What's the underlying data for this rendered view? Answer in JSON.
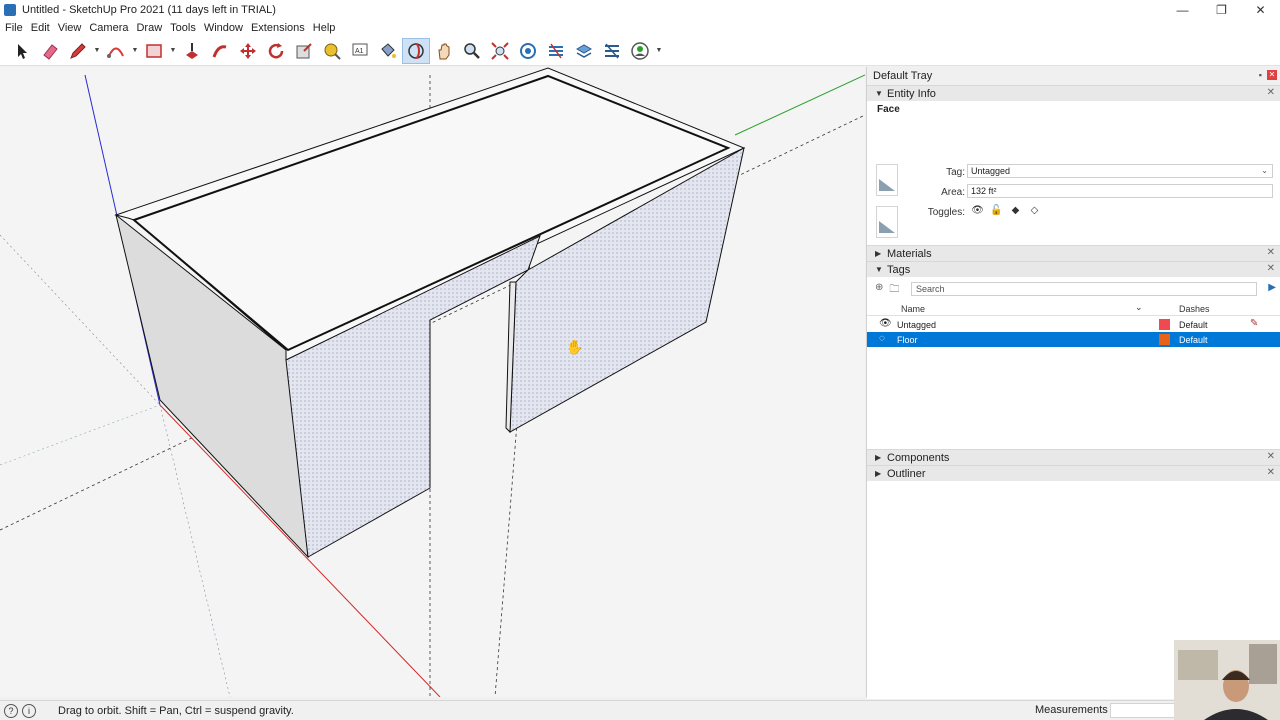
{
  "window": {
    "title": "Untitled - SketchUp Pro 2021 (11 days left in TRIAL)",
    "minimize": "—",
    "restore": "❐",
    "close": "✕"
  },
  "menu": [
    "File",
    "Edit",
    "View",
    "Camera",
    "Draw",
    "Tools",
    "Window",
    "Extensions",
    "Help"
  ],
  "toolbar": {
    "tools": [
      "select-icon",
      "eraser-icon",
      "pencil-icon",
      "arc-icon",
      "rectangle-icon",
      "push-pull-icon",
      "follow-me-icon",
      "move-icon",
      "rotate-icon",
      "scale-icon",
      "tape-measure-icon",
      "text-icon",
      "paint-bucket-icon",
      "orbit-icon",
      "pan-icon",
      "zoom-icon",
      "zoom-extents-icon",
      "3d-warehouse-icon",
      "extension-warehouse-icon",
      "layout-icon",
      "extension-manager-icon",
      "user-account-icon"
    ],
    "active_tool": "orbit-icon"
  },
  "tray": {
    "title": "Default Tray",
    "entity_info": {
      "header": "Entity Info",
      "kind": "Face",
      "tag_label": "Tag:",
      "tag_value": "Untagged",
      "area_label": "Area:",
      "area_value": "132 ft²",
      "toggles_label": "Toggles:"
    },
    "materials": {
      "header": "Materials"
    },
    "tags": {
      "header": "Tags",
      "search_placeholder": "Search",
      "col_name": "Name",
      "col_dashes": "Dashes",
      "rows": [
        {
          "name": "Untagged",
          "color": "#f04a50",
          "dashes": "Default",
          "selected": false
        },
        {
          "name": "Floor",
          "color": "#e8621a",
          "dashes": "Default",
          "selected": true
        }
      ]
    },
    "components": {
      "header": "Components"
    },
    "outliner": {
      "header": "Outliner"
    }
  },
  "status": {
    "hint": "Drag to orbit. Shift = Pan, Ctrl = suspend gravity.",
    "measurements_label": "Measurements",
    "measurements_value": ""
  },
  "colors": {
    "axis_red": "#d42a2a",
    "axis_green": "#2aa12a",
    "axis_blue": "#2a2ad4",
    "selection_blue": "#0078d7",
    "face_fill": "#e4e6ee"
  }
}
